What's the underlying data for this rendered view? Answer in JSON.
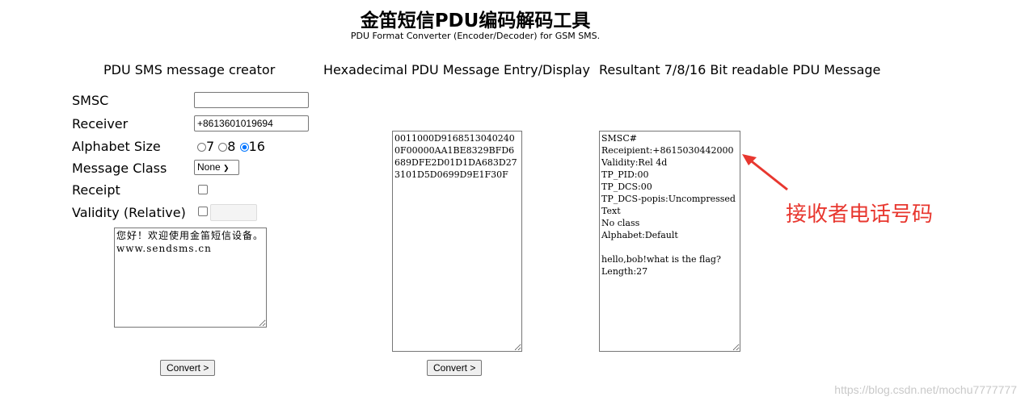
{
  "header": {
    "title": "金笛短信PDU编码解码工具",
    "subtitle": "PDU Format Converter (Encoder/Decoder) for GSM SMS."
  },
  "columns": {
    "creator": "PDU SMS message creator",
    "hex": "Hexadecimal PDU Message Entry/Display",
    "result": "Resultant 7/8/16 Bit readable PDU Message"
  },
  "form": {
    "smsc_label": "SMSC",
    "smsc_value": "",
    "receiver_label": "Receiver",
    "receiver_value": "+8613601019694",
    "alphabet_label": "Alphabet Size",
    "alphabet_options": [
      "7",
      "8",
      "16"
    ],
    "alphabet_selected": "16",
    "class_label": "Message Class",
    "class_value": "None",
    "receipt_label": "Receipt",
    "validity_label": "Validity (Relative)",
    "validity_value": "",
    "message": "您好！欢迎使用金笛短信设备。www.sendsms.cn",
    "convert_label": "Convert >"
  },
  "hex": {
    "value": "0011000D91685130402400F00000AA1BE8329BFD6689DFE2D01D1DA683D273101D5D0699D9E1F30F",
    "convert_label": "Convert >"
  },
  "result": {
    "value": "SMSC#\nReceipient:+8615030442000\nValidity:Rel 4d\nTP_PID:00\nTP_DCS:00\nTP_DCS-popis:Uncompressed Text\nNo class\nAlphabet:Default\n\nhello,bob!what is the flag?\nLength:27"
  },
  "annotation": {
    "text": "接收者电话号码",
    "color": "#e8372f"
  },
  "watermark": "https://blog.csdn.net/mochu7777777"
}
